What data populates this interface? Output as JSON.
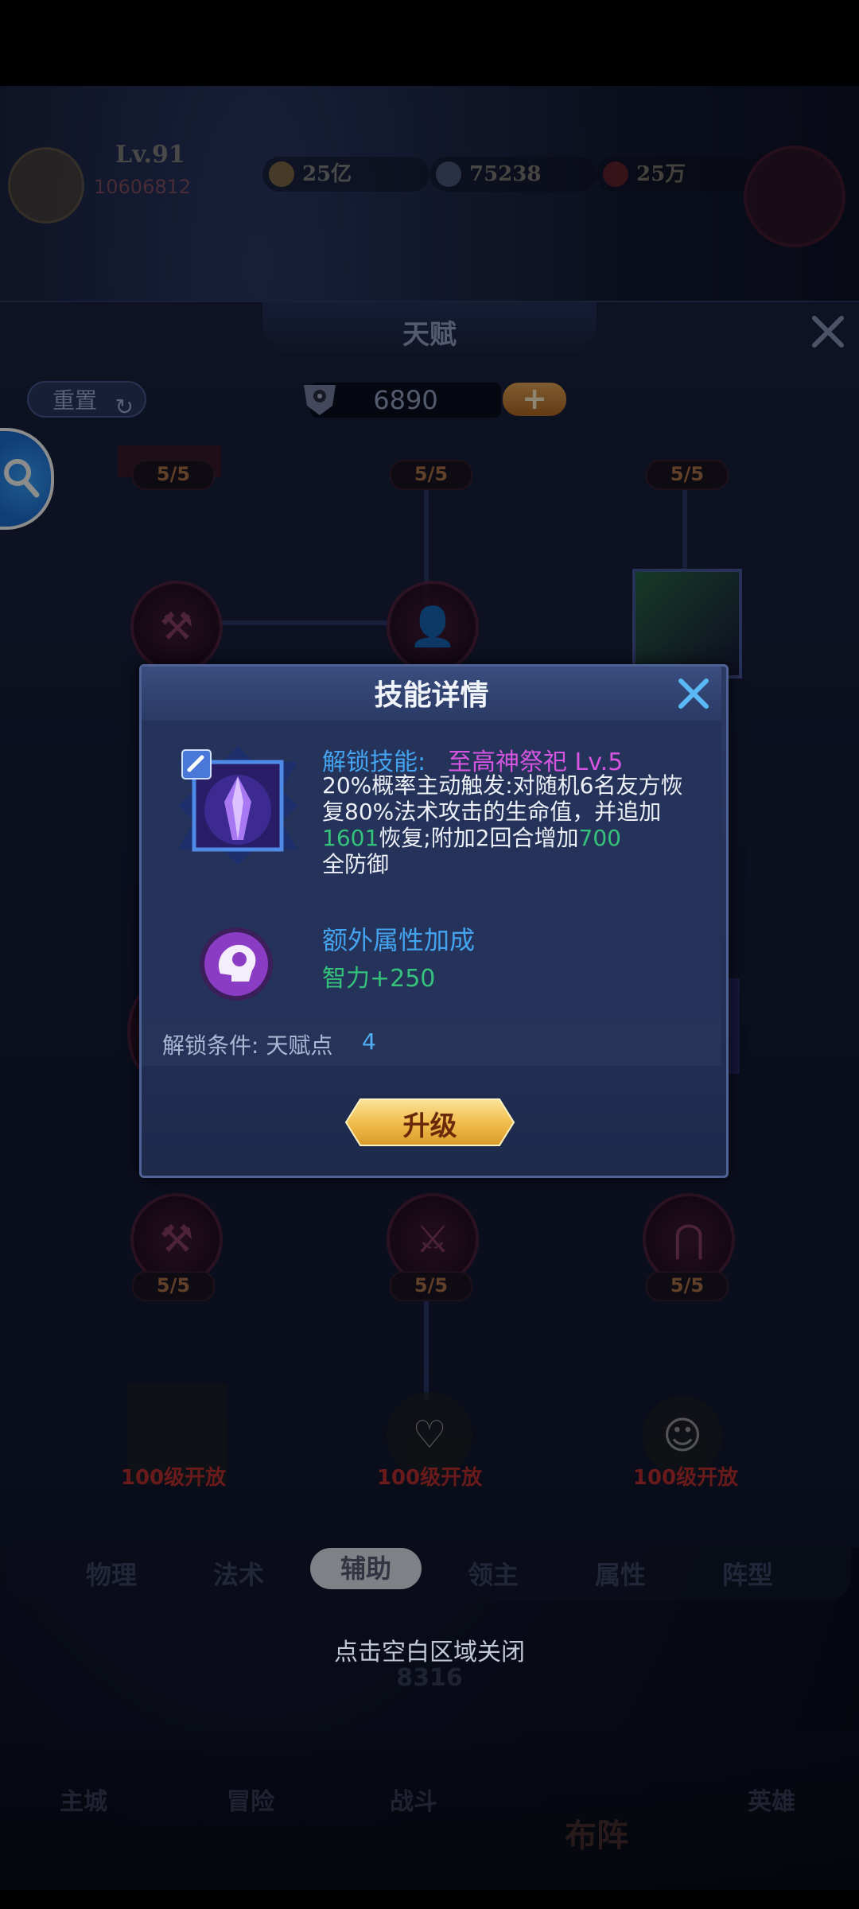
{
  "hud": {
    "level": "Lv.91",
    "power": "10606812",
    "resources": [
      {
        "icon": "gold-coin-icon",
        "value": "25亿"
      },
      {
        "icon": "diamond-icon",
        "value": "75238"
      },
      {
        "icon": "ruby-icon",
        "value": "25万"
      }
    ]
  },
  "talent_panel": {
    "title": "天赋",
    "reset_label": "重置",
    "talent_points": "6890",
    "plus_label": "+",
    "nodes": [
      {
        "count": "5/5"
      },
      {
        "count": "5/5"
      },
      {
        "count": "5/5"
      },
      {
        "count": "5/5"
      },
      {
        "count": "5/5"
      },
      {
        "count": "5/5"
      }
    ],
    "locked_label": "100级开放",
    "tabs": [
      "物理",
      "法术",
      "辅助",
      "领主",
      "属性",
      "阵型"
    ],
    "active_tab": "辅助"
  },
  "dialog": {
    "title": "技能详情",
    "skill_label": "解锁技能:",
    "skill_name": "至高神祭祀 Lv.5",
    "desc_1": "20%概率主动触发:对随机6名友方恢复80%法术攻击的生命值，并追加",
    "desc_heal_value": "1601",
    "desc_2": "恢复;附加2回合增加",
    "desc_def_value": "700",
    "desc_3": "全防御",
    "extra_attr_title": "额外属性加成",
    "extra_attr_value": "智力+250",
    "unlock_condition_label": "解锁条件: 天赋点",
    "unlock_condition_value": "4",
    "upgrade_label": "升级"
  },
  "close_hint": "点击空白区域关闭",
  "background": {
    "bottom_nav": [
      "主城",
      "冒险",
      "战斗",
      "布阵",
      "英雄"
    ],
    "stat_value": "8316"
  },
  "colors": {
    "accent_blue": "#44a3ee",
    "skill_purple": "#d655e0",
    "value_green": "#35c27a",
    "locked_red": "#c03030"
  }
}
